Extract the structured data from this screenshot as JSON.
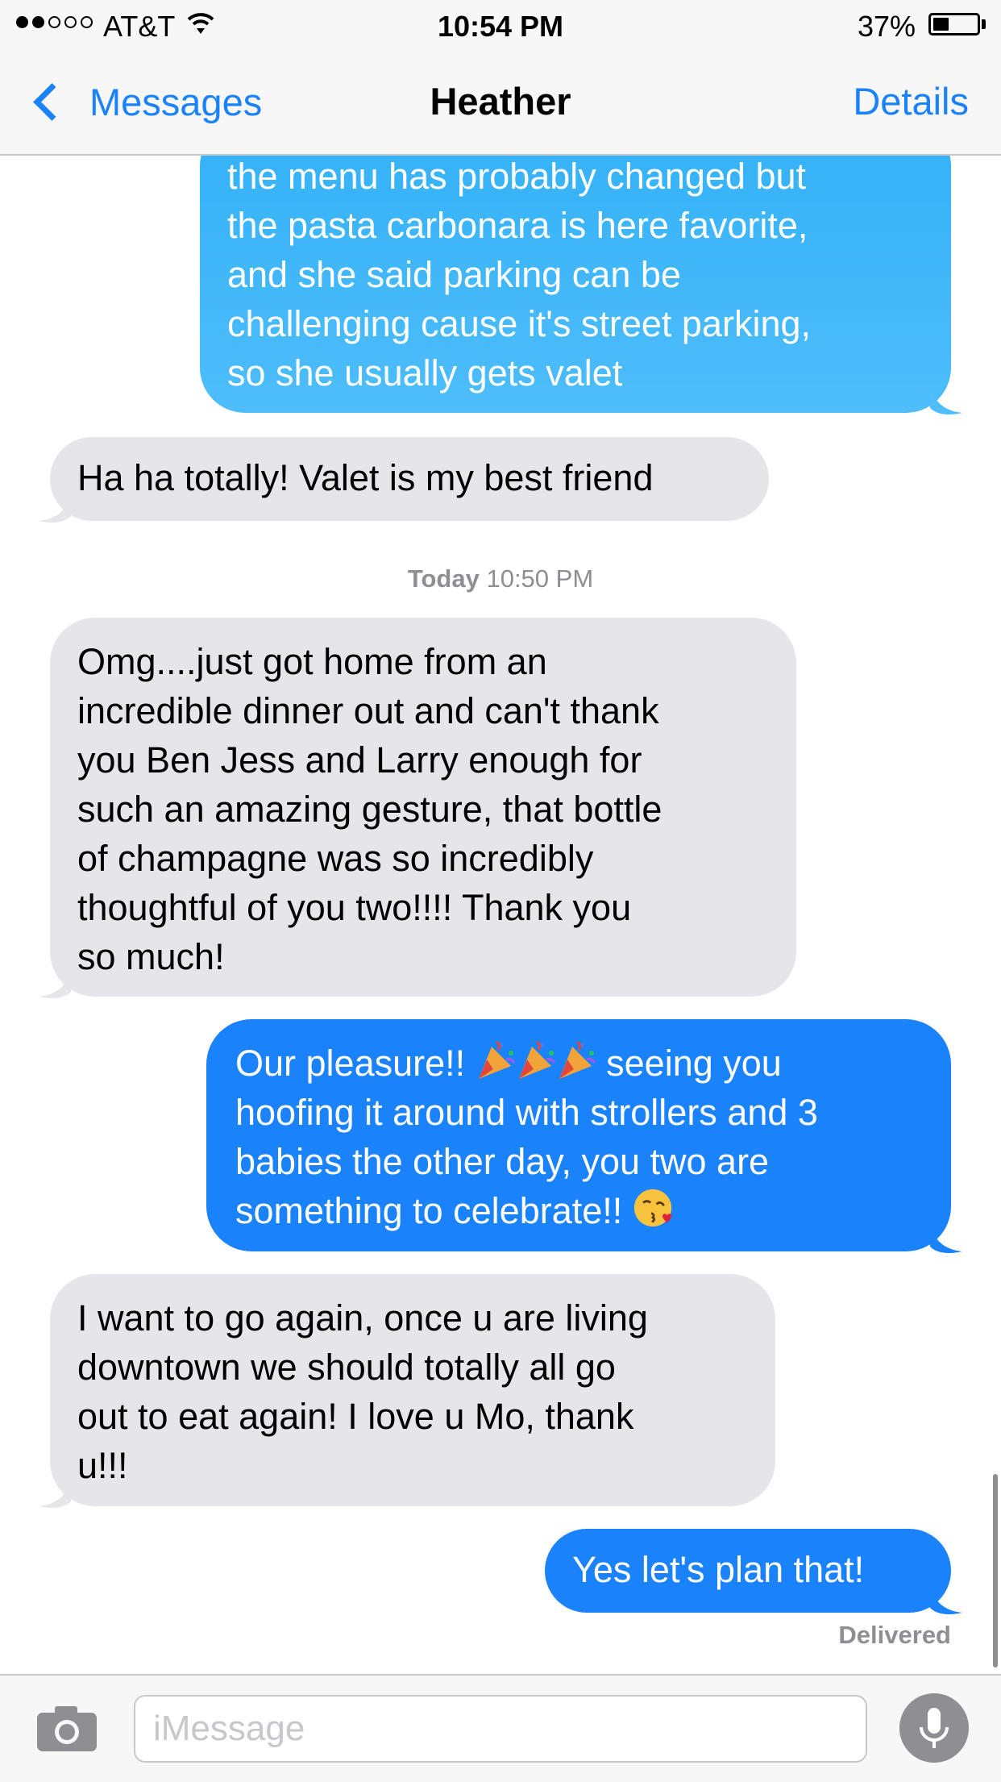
{
  "status": {
    "carrier": "AT&T",
    "time": "10:54 PM",
    "battery": "37%",
    "battery_level": 0.37
  },
  "nav": {
    "back": "Messages",
    "title": "Heather",
    "details": "Details"
  },
  "messages": [
    {
      "sender": "me",
      "text": "the menu has probably changed but\nthe pasta carbonara is here favorite,\nand she said parking can be\nchallenging cause it's street parking,\nso she usually gets valet"
    },
    {
      "sender": "them",
      "text": "Ha ha totally! Valet is my best friend"
    },
    {
      "sender": "them",
      "text": "Omg....just got home from an\nincredible dinner out and can't thank\nyou Ben Jess and Larry enough for\nsuch an amazing gesture, that bottle\nof champagne was so incredibly\nthoughtful of you two!!!! Thank you\nso much!"
    },
    {
      "sender": "me",
      "line1_start": "Our pleasure!! ",
      "line1_end": " seeing you",
      "line1_emoji": "party-popper",
      "rest": "hoofing it around with strollers and 3\nbabies the other day, you two are",
      "last_line": "something to celebrate!! ",
      "last_emoji": "face-blowing-kiss"
    },
    {
      "sender": "them",
      "text": "I want to go again, once u are living\ndowntown we should totally all go\nout to eat again! I love u Mo, thank\nu!!!"
    },
    {
      "sender": "me",
      "text": "Yes let's plan that!"
    }
  ],
  "timestamp": {
    "day": "Today",
    "time": " 10:50 PM"
  },
  "delivered": "Delivered",
  "input": {
    "placeholder": "iMessage"
  },
  "colors": {
    "accent": "#1a82fb",
    "incoming_bubble": "#e5e5ea",
    "outgoing_bubble": "#1a82fb",
    "older_outgoing_bubble": "#4ebdfa"
  }
}
